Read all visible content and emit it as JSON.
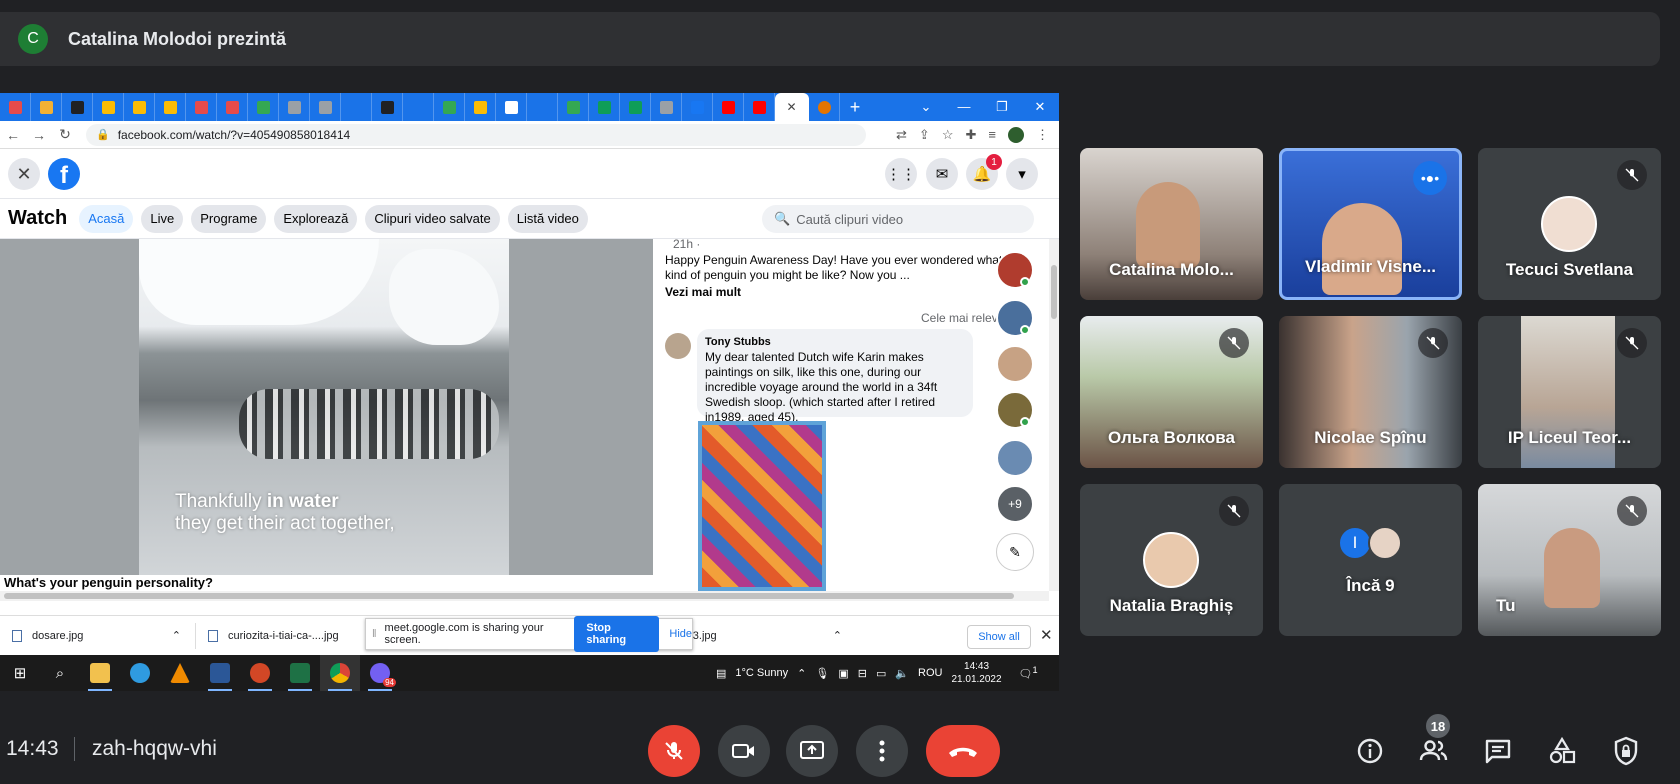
{
  "banner": {
    "avatar_letter": "C",
    "title": "Catalina Molodoi prezintă"
  },
  "browser": {
    "url": "facebook.com/watch/?v=405490858018414",
    "tab_colors": [
      "#e54b4b",
      "#f2b134",
      "#202124",
      "#fbbc04",
      "#fbbc04",
      "#fbbc04",
      "#e54b4b",
      "#e54b4b",
      "#34a853",
      "#9aa0a6",
      "#9aa0a6",
      "#1a73e8",
      "#202124",
      "#1a73e8",
      "#34a853",
      "#fbbc04",
      "#ffffff",
      "#1a73e8",
      "#34a853",
      "#0f9d58",
      "#0f9d58",
      "#9aa0a6",
      "#1877f2",
      "#ff0000",
      "#ff0000"
    ]
  },
  "facebook": {
    "notif_count": "1",
    "watch_label": "Watch",
    "nav": [
      "Acasă",
      "Live",
      "Programe",
      "Explorează",
      "Clipuri video salvate",
      "Listă video"
    ],
    "search_placeholder": "Caută clipuri video",
    "caption_line1_a": "Thankfully ",
    "caption_line1_b": "in water",
    "caption_line2": "they get their act together,",
    "video_title": "What's your penguin personality?",
    "post_time": "21h · ",
    "post_text": "Happy Penguin Awareness Day! Have you ever wondered what kind of penguin you might be like? Now you ...",
    "see_more": "Vezi mai mult",
    "sort_label": "Cele mai relevante",
    "commenter": "Tony Stubbs",
    "comment": "My dear talented Dutch wife Karin makes paintings on silk, like this one, during our incredible voyage around the world in a 34ft Swedish sloop. (which started after I retired in1989, aged 45).",
    "more_contacts": "+9"
  },
  "downloads": {
    "items": [
      "dosare.jpg",
      "curiozita-i-tiai-ca-....jpg",
      "gi_03.jpg"
    ],
    "share_text": "meet.google.com is sharing your screen.",
    "stop_sharing": "Stop sharing",
    "hide": "Hide",
    "show_all": "Show all"
  },
  "taskbar": {
    "weather": "1°C  Sunny",
    "lang": "ROU",
    "time": "14:43",
    "date": "21.01.2022",
    "badge": "94",
    "notif": "1"
  },
  "participants": [
    {
      "name": "Catalina Molo..."
    },
    {
      "name": "Vladimir Visne..."
    },
    {
      "name": "Tecuci Svetlana"
    },
    {
      "name": "Ольга Волкова"
    },
    {
      "name": "Nicolae Spînu"
    },
    {
      "name": "IP Liceul Teor..."
    },
    {
      "name": "Natalia Braghiș"
    },
    {
      "name": "Încă 9",
      "initial": "I"
    },
    {
      "name": "Tu"
    }
  ],
  "meeting": {
    "time": "14:43",
    "code": "zah-hqqw-vhi",
    "people_count": "18"
  }
}
